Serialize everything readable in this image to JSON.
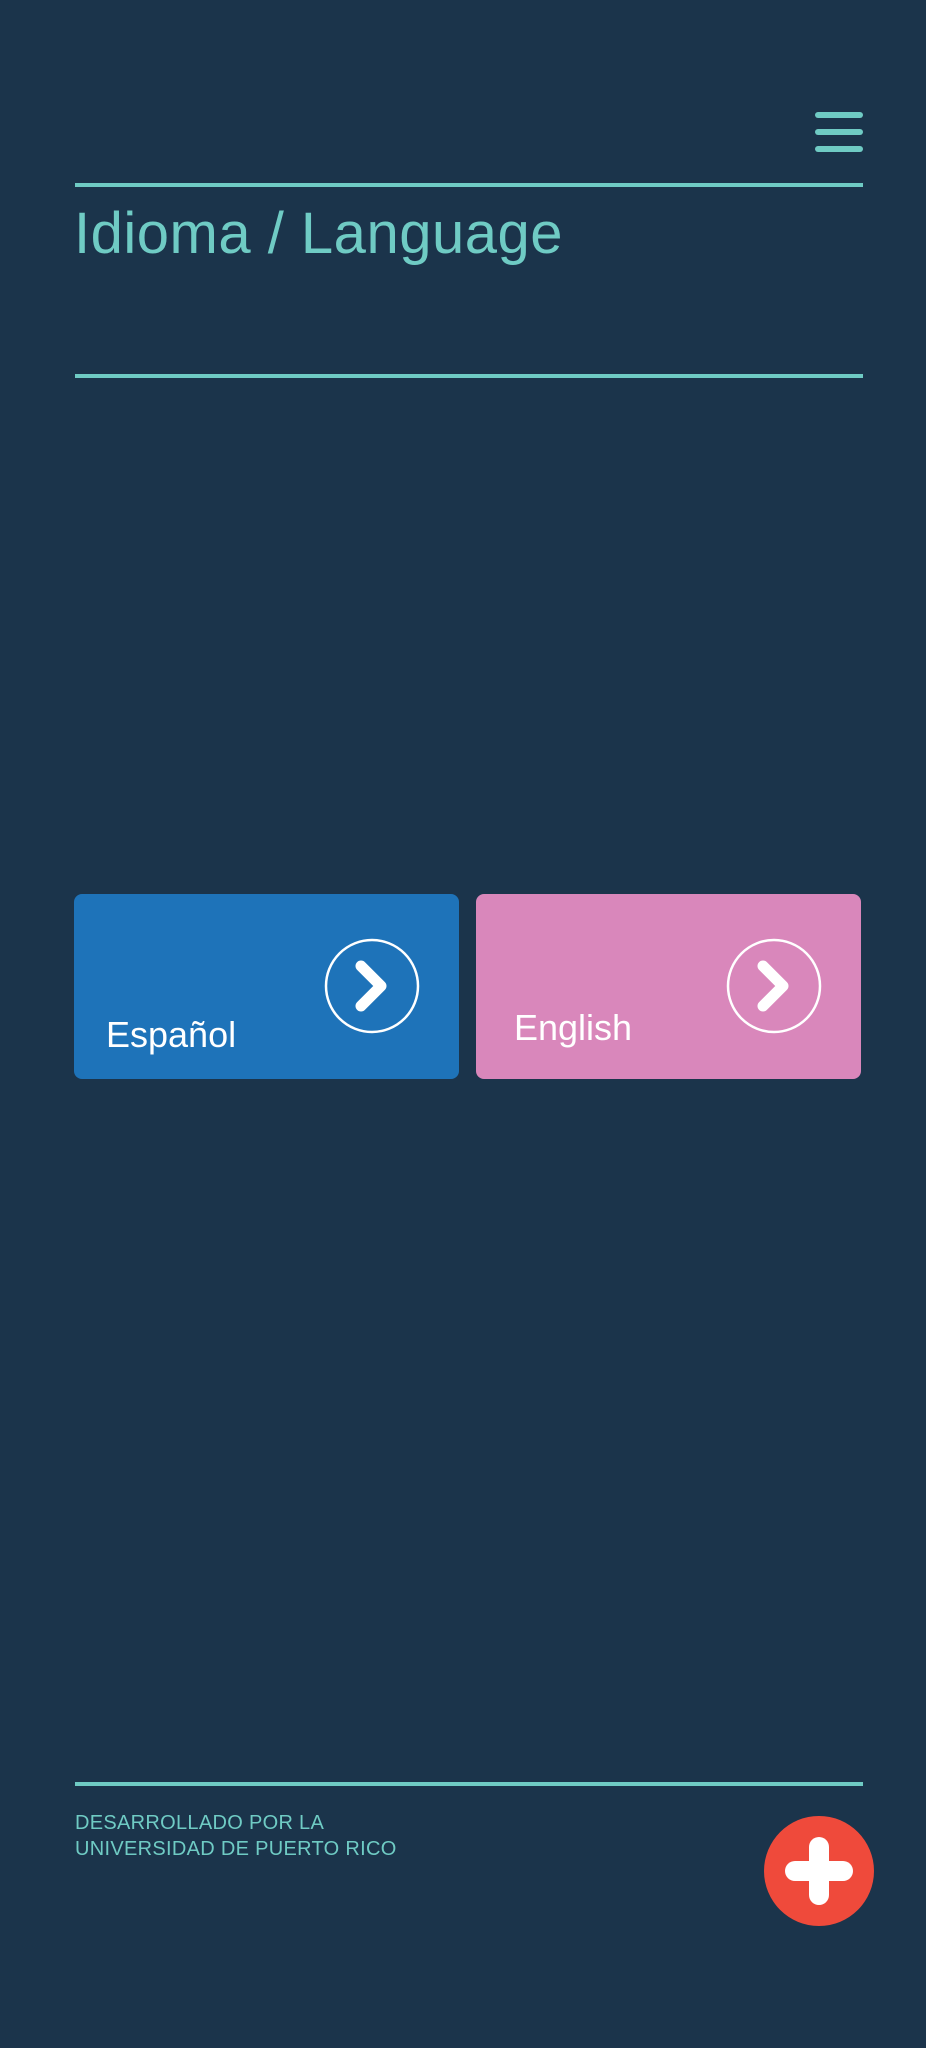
{
  "header": {
    "title": "Idioma / Language",
    "menu_icon": "hamburger-menu-icon"
  },
  "languages": [
    {
      "label": "Español",
      "color": "#1e73b9",
      "icon": "chevron-right-circle-icon"
    },
    {
      "label": "English",
      "color": "#d987bb",
      "icon": "chevron-right-circle-icon"
    }
  ],
  "footer": {
    "line1": "DESARROLLADO POR LA",
    "line2": "UNIVERSIDAD DE PUERTO RICO"
  },
  "fab": {
    "icon": "plus-icon",
    "color": "#ef4a3b"
  },
  "theme": {
    "background": "#1b344b",
    "accent": "#6fcbc4"
  }
}
